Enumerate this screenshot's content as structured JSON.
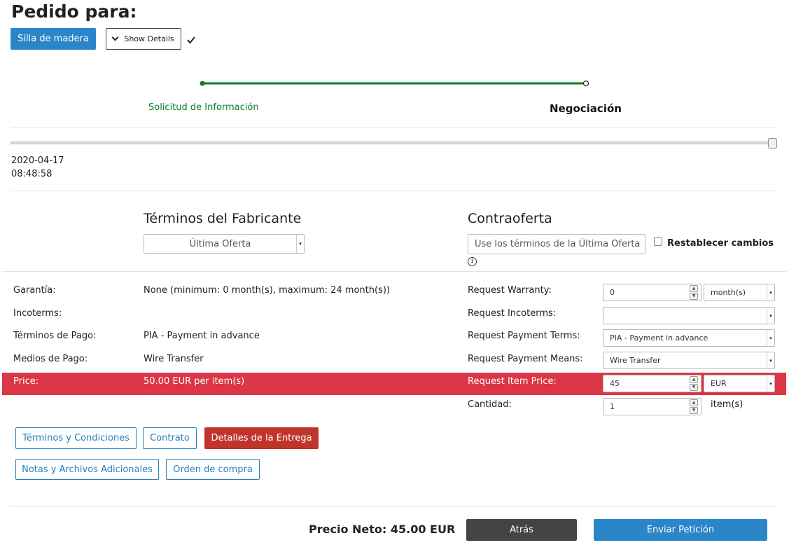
{
  "header": {
    "title": "Pedido para:",
    "product_button": "Silla de madera",
    "details_button": "Show Details"
  },
  "progress": {
    "step1": "Solicitud de Información",
    "step2": "Negociación",
    "slider_value": 1.0,
    "date": "2020-04-17",
    "time": "08:48:58"
  },
  "terms": {
    "manufacturer_heading": "Términos del Fabricante",
    "manufacturer_select": "Última Oferta",
    "counter_heading": "Contraoferta",
    "counter_button": "Use los términos de la Última Oferta",
    "reset_label": "Restablecer cambios",
    "info_icon": "i"
  },
  "rows": {
    "warranty_label": "Garantía:",
    "warranty_value": "None (minimum: 0 month(s), maximum: 24 month(s))",
    "warranty_req_label": "Request Warranty:",
    "warranty_req_value": "0",
    "warranty_unit": "month(s)",
    "incoterms_label": "Incoterms:",
    "incoterms_req_label": "Request Incoterms:",
    "incoterms_req_value": "",
    "payterms_label": "Términos de Pago:",
    "payterms_value": "PIA - Payment in advance",
    "payterms_req_label": "Request Payment Terms:",
    "payterms_req_value": "PIA - Payment in advance",
    "paymeans_label": "Medios de Pago:",
    "paymeans_value": "Wire Transfer",
    "paymeans_req_label": "Request Payment Means:",
    "paymeans_req_value": "Wire Transfer",
    "price_label": "Price:",
    "price_value": "50.00 EUR per item(s)",
    "price_req_label": "Request Item Price:",
    "price_req_value": "45",
    "price_currency": "EUR",
    "qty_label": "Cantidad:",
    "qty_value": "1",
    "qty_unit": "item(s)"
  },
  "tabs": {
    "terms_conditions": "Términos y Condiciones",
    "contract": "Contrato",
    "delivery": "Detalles de la Entrega",
    "notes": "Notas y Archivos Adicionales",
    "purchase_order": "Orden de compra"
  },
  "footer": {
    "net_price": "Precio Neto: 45.00 EUR",
    "back": "Atrás",
    "send": "Enviar Petición"
  },
  "colors": {
    "primary": "#2a86c9",
    "success": "#0a7d1e",
    "danger": "#dc3545",
    "delivery_tab": "#c0352b"
  }
}
